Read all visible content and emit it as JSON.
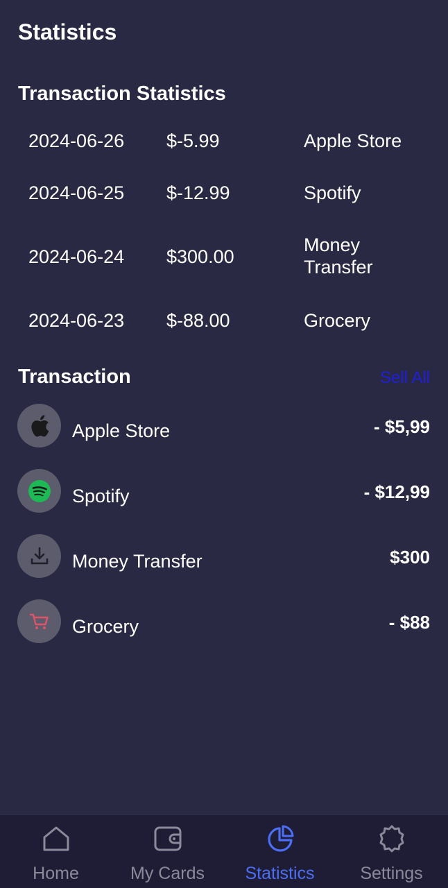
{
  "header": {
    "title": "Statistics"
  },
  "stats": {
    "title": "Transaction Statistics",
    "rows": [
      {
        "date": "2024-06-26",
        "amount": "$-5.99",
        "merchant": "Apple Store"
      },
      {
        "date": "2024-06-25",
        "amount": "$-12.99",
        "merchant": "Spotify"
      },
      {
        "date": "2024-06-24",
        "amount": "$300.00",
        "merchant": "Money Transfer"
      },
      {
        "date": "2024-06-23",
        "amount": "$-88.00",
        "merchant": "Grocery"
      }
    ]
  },
  "transactions": {
    "title": "Transaction",
    "see_all": "Sell All",
    "items": [
      {
        "name": "Apple Store",
        "amount": "- $5,99",
        "icon": "apple-icon"
      },
      {
        "name": "Spotify",
        "amount": "- $12,99",
        "icon": "spotify-icon"
      },
      {
        "name": "Money Transfer",
        "amount": "$300",
        "icon": "download-icon"
      },
      {
        "name": "Grocery",
        "amount": "- $88",
        "icon": "cart-icon"
      }
    ]
  },
  "nav": {
    "items": [
      {
        "label": "Home",
        "icon": "home-icon",
        "active": false
      },
      {
        "label": "My Cards",
        "icon": "wallet-icon",
        "active": false
      },
      {
        "label": "Statistics",
        "icon": "pie-chart-icon",
        "active": true
      },
      {
        "label": "Settings",
        "icon": "gear-icon",
        "active": false
      }
    ]
  },
  "colors": {
    "background": "#2a2944",
    "nav_background": "#1e1d35",
    "accent": "#4b6ef5",
    "link": "#1f1fd8",
    "spotify": "#1db954",
    "grocery": "#e0546a"
  }
}
